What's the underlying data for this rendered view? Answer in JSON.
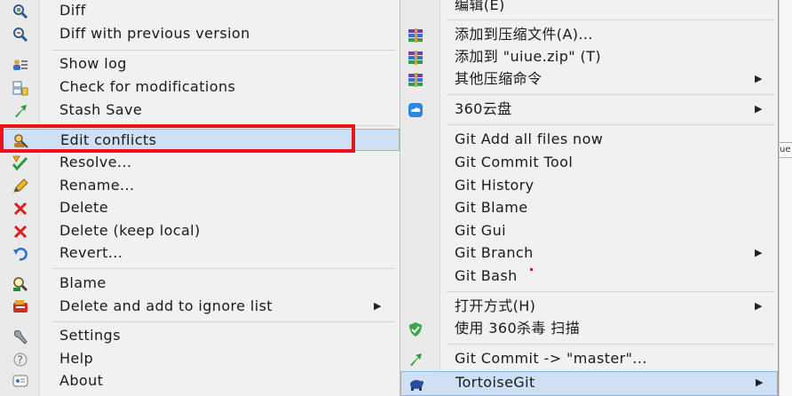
{
  "left_menu": {
    "items": [
      {
        "label": "Diff",
        "icon": "diff-magnifier-icon"
      },
      {
        "label": "Diff with previous version",
        "icon": "diff-previous-icon"
      },
      {
        "label": "Show log",
        "icon": "show-log-icon"
      },
      {
        "label": "Check for modifications",
        "icon": "check-modifications-icon"
      },
      {
        "label": "Stash Save",
        "icon": "stash-save-icon"
      },
      {
        "label": "Edit conflicts",
        "icon": "edit-conflicts-icon"
      },
      {
        "label": "Resolve...",
        "icon": "resolve-icon"
      },
      {
        "label": "Rename...",
        "icon": "rename-icon"
      },
      {
        "label": "Delete",
        "icon": "delete-x-icon"
      },
      {
        "label": "Delete (keep local)",
        "icon": "delete-keep-local-icon"
      },
      {
        "label": "Revert...",
        "icon": "revert-icon"
      },
      {
        "label": "Blame",
        "icon": "blame-icon"
      },
      {
        "label": "Delete and add to ignore list",
        "icon": "ignore-list-icon",
        "submenu": true
      },
      {
        "label": "Settings",
        "icon": "settings-icon"
      },
      {
        "label": "Help",
        "icon": "help-icon"
      },
      {
        "label": "About",
        "icon": "about-icon"
      }
    ],
    "highlighted": "Edit conflicts",
    "submenu_arrow": "▶"
  },
  "right_menu": {
    "items": [
      {
        "label": "编辑(E)"
      },
      {
        "label": "添加到压缩文件(A)...",
        "icon": "winrar-archive-icon"
      },
      {
        "label": "添加到 \"uiue.zip\" (T)",
        "icon": "winrar-zip-icon"
      },
      {
        "label": "其他压缩命令",
        "icon": "winrar-more-icon",
        "submenu": true
      },
      {
        "label": "360云盘",
        "icon": "360-cloud-icon",
        "submenu": true
      },
      {
        "label": "Git Add all files now"
      },
      {
        "label": "Git Commit Tool"
      },
      {
        "label": "Git History"
      },
      {
        "label": "Git Blame"
      },
      {
        "label": "Git Gui"
      },
      {
        "label": "Git Branch",
        "submenu": true
      },
      {
        "label": "Git Bash"
      },
      {
        "label": "打开方式(H)",
        "submenu": true
      },
      {
        "label": "使用 360杀毒 扫描",
        "icon": "360-antivirus-shield-icon"
      },
      {
        "label": "Git Commit -> \"master\"...",
        "icon": "git-commit-arrow-icon"
      },
      {
        "label": "TortoiseGit",
        "icon": "tortoisegit-icon",
        "submenu": true
      }
    ],
    "highlighted": "TortoiseGit",
    "submenu_arrow": "▶"
  },
  "right_strip": {
    "text": "ue"
  },
  "colors": {
    "highlight": "#cfe0f4",
    "red_box": "#e8141a",
    "menu_bg": "#f1f1f1"
  }
}
